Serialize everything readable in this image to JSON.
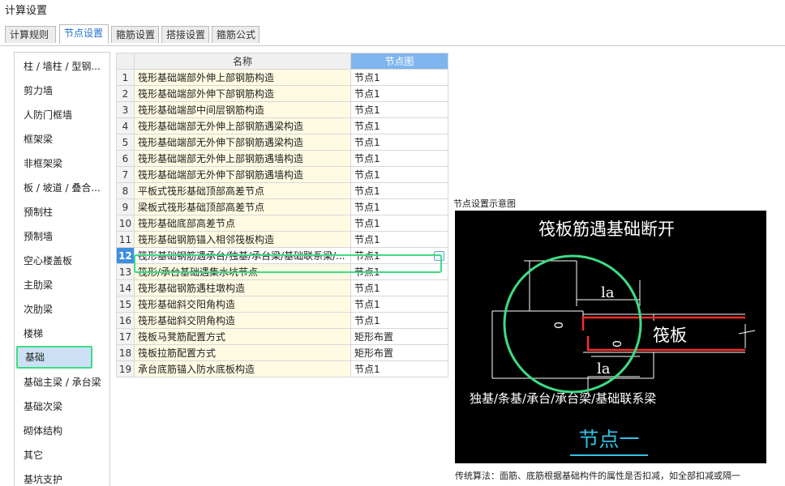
{
  "window": {
    "title": "计算设置"
  },
  "tabs": [
    {
      "label": "计算规则",
      "active": false
    },
    {
      "label": "节点设置",
      "active": true
    },
    {
      "label": "箍筋设置",
      "active": false
    },
    {
      "label": "搭接设置",
      "active": false
    },
    {
      "label": "箍筋公式",
      "active": false
    }
  ],
  "sidebar": {
    "items": [
      {
        "label": "柱 / 墙柱 / 型钢..."
      },
      {
        "label": "剪力墙"
      },
      {
        "label": "人防门框墙"
      },
      {
        "label": "框架梁"
      },
      {
        "label": "非框架梁"
      },
      {
        "label": "板 / 坡道 / 叠合..."
      },
      {
        "label": "预制柱"
      },
      {
        "label": "预制墙"
      },
      {
        "label": "空心楼盖板"
      },
      {
        "label": "主肋梁"
      },
      {
        "label": "次肋梁"
      },
      {
        "label": "楼梯"
      },
      {
        "label": "基础"
      },
      {
        "label": "基础主梁 / 承台梁"
      },
      {
        "label": "基础次梁"
      },
      {
        "label": "砌体结构"
      },
      {
        "label": "其它"
      },
      {
        "label": "基坑支护"
      }
    ],
    "selected_index": 12
  },
  "table": {
    "columns": {
      "name": "名称",
      "node": "节点图"
    },
    "rows": [
      {
        "num": "1",
        "name": "筏形基础端部外伸上部钢筋构造",
        "node": "节点1"
      },
      {
        "num": "2",
        "name": "筏形基础端部外伸下部钢筋构造",
        "node": "节点1"
      },
      {
        "num": "3",
        "name": "筏形基础端部中间层钢筋构造",
        "node": "节点1"
      },
      {
        "num": "4",
        "name": "筏形基础端部无外伸上部钢筋遇梁构造",
        "node": "节点1"
      },
      {
        "num": "5",
        "name": "筏形基础端部无外伸下部钢筋遇梁构造",
        "node": "节点1"
      },
      {
        "num": "6",
        "name": "筏形基础端部无外伸上部钢筋遇墙构造",
        "node": "节点1"
      },
      {
        "num": "7",
        "name": "筏形基础端部无外伸下部钢筋遇墙构造",
        "node": "节点1"
      },
      {
        "num": "8",
        "name": "平板式筏形基础顶部高差节点",
        "node": "节点1"
      },
      {
        "num": "9",
        "name": "梁板式筏形基础顶部高差节点",
        "node": "节点1"
      },
      {
        "num": "10",
        "name": "筏形基础底部高差节点",
        "node": "节点1"
      },
      {
        "num": "11",
        "name": "筏形基础钢筋锚入相邻筏板构造",
        "node": "节点1"
      },
      {
        "num": "12",
        "name": "筏形基础钢筋遇承台/独基/承台梁/基础联系梁/...",
        "node": "节点1"
      },
      {
        "num": "13",
        "name": "筏形/承台基础遇集水坑节点",
        "node": "节点1"
      },
      {
        "num": "14",
        "name": "筏形基础钢筋遇柱墩构造",
        "node": "节点1"
      },
      {
        "num": "15",
        "name": "筏形基础斜交阳角构造",
        "node": "节点1"
      },
      {
        "num": "16",
        "name": "筏形基础斜交阴角构造",
        "node": "节点1"
      },
      {
        "num": "17",
        "name": "筏板马凳筋配置方式",
        "node": "矩形布置"
      },
      {
        "num": "18",
        "name": "筏板拉筋配置方式",
        "node": "矩形布置"
      },
      {
        "num": "19",
        "name": "承台底筋锚入防水底板构造",
        "node": "节点1"
      }
    ],
    "selected_index": 11,
    "edit_button_label": "···"
  },
  "preview": {
    "label": "节点设置示意图",
    "diagram_title": "筏板筋遇基础断开",
    "slab_label": "筏板",
    "la_top": "la",
    "la_bottom": "la",
    "zero_left": "0",
    "zero_right": "0",
    "foundation_types": "独基/条基/承台/承台梁/基础联系梁",
    "node_name": "节点一",
    "colors": {
      "background": "#000000",
      "rebar": "#ff2b2b",
      "lines": "#ffffff",
      "node_name": "#30c4e8",
      "highlight": "#3ddc84"
    }
  },
  "footer": {
    "text": "传统算法：面筋、底筋根据基础构件的属性是否扣减，如全部扣减或隔一"
  }
}
